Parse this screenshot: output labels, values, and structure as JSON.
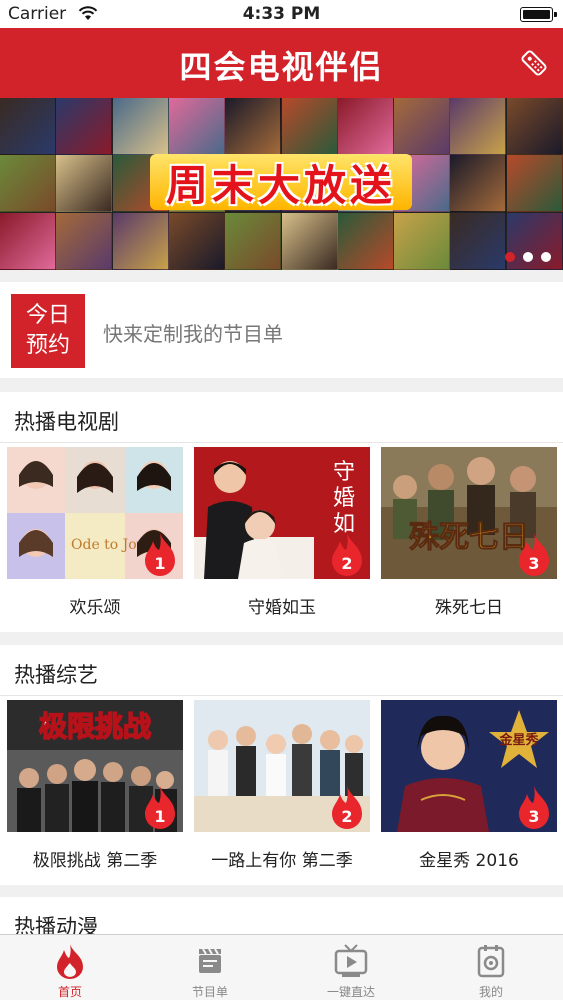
{
  "status_bar": {
    "carrier": "Carrier",
    "time": "4:33 PM"
  },
  "header": {
    "app_title": "四会电视伴侣"
  },
  "banner": {
    "title": "周末大放送",
    "dots_count": 3,
    "active_dot": 0
  },
  "reservation": {
    "badge_line1": "今日",
    "badge_line2": "预约",
    "hint": "快来定制我的节目单"
  },
  "sections": [
    {
      "title": "热播电视剧",
      "items": [
        {
          "name": "欢乐颂",
          "rank": "1"
        },
        {
          "name": "守婚如玉",
          "rank": "2"
        },
        {
          "name": "殊死七日",
          "rank": "3"
        }
      ]
    },
    {
      "title": "热播综艺",
      "items": [
        {
          "name": "极限挑战 第二季",
          "rank": "1"
        },
        {
          "name": "一路上有你 第二季",
          "rank": "2"
        },
        {
          "name": "金星秀 2016",
          "rank": "3"
        }
      ]
    },
    {
      "title": "热播动漫",
      "items": []
    }
  ],
  "tab_bar": {
    "tabs": [
      {
        "label": "首页",
        "icon": "flame-icon",
        "active": true
      },
      {
        "label": "节目单",
        "icon": "clapperboard-icon",
        "active": false
      },
      {
        "label": "一键直达",
        "icon": "tv-icon",
        "active": false
      },
      {
        "label": "我的",
        "icon": "profile-icon",
        "active": false
      }
    ]
  },
  "colors": {
    "brand_red": "#d2232a",
    "background": "#f0f0f0",
    "inactive_tab": "#888888"
  }
}
